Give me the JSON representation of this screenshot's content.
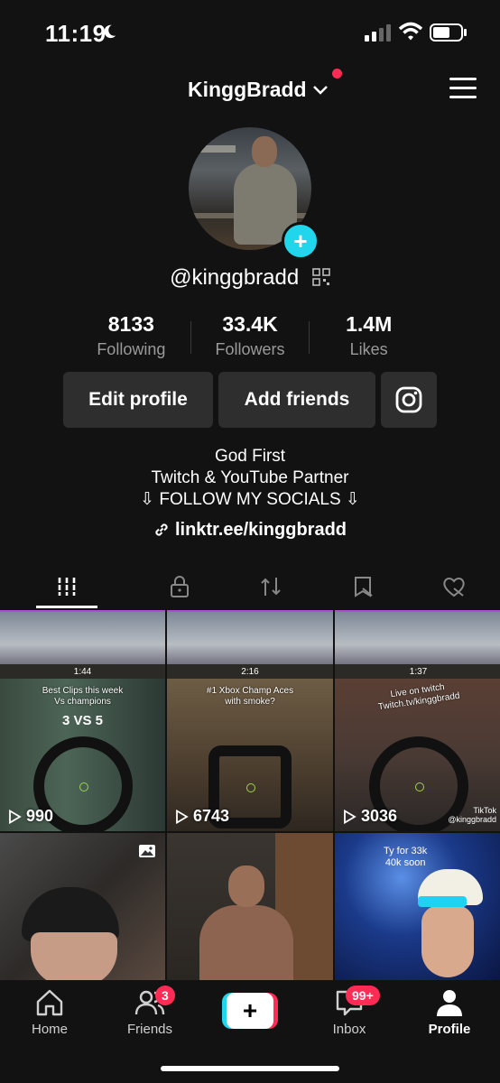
{
  "status_bar": {
    "time": "11:19"
  },
  "header": {
    "username": "KinggBradd"
  },
  "profile": {
    "handle": "@kinggbradd",
    "stats": [
      {
        "value": "8133",
        "label": "Following"
      },
      {
        "value": "33.4K",
        "label": "Followers"
      },
      {
        "value": "1.4M",
        "label": "Likes"
      }
    ],
    "buttons": {
      "edit": "Edit profile",
      "add_friends": "Add friends"
    },
    "bio": [
      "God First",
      "Twitch & YouTube Partner",
      "⇩ FOLLOW MY SOCIALS ⇩"
    ],
    "link": "linktr.ee/kinggbradd"
  },
  "videos": [
    {
      "views": "990",
      "hud_time": "1:44",
      "caption": "Best Clips this week\nVs champions",
      "score": "3 VS 5"
    },
    {
      "views": "6743",
      "hud_time": "2:16",
      "caption": "#1 Xbox Champ Aces\nwith smoke?"
    },
    {
      "views": "3036",
      "hud_time": "1:37",
      "caption": "Live on twitch\nTwitch.tv/kinggbradd",
      "watermark": "TikTok",
      "watermark_handle": "@kinggbradd"
    },
    {
      "caption": ""
    },
    {
      "caption": ""
    },
    {
      "caption": "Ty for 33k\n40k soon"
    }
  ],
  "bottom_nav": {
    "home": "Home",
    "friends": "Friends",
    "friends_badge": "3",
    "inbox": "Inbox",
    "inbox_badge": "99+",
    "profile": "Profile"
  },
  "colors": {
    "accent_pink": "#fe2c55",
    "accent_cyan": "#20d5ec",
    "background": "#121212"
  }
}
